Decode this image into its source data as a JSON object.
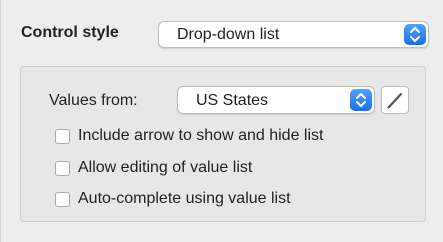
{
  "control_style": {
    "label": "Control style",
    "selected": "Drop-down list"
  },
  "values_from": {
    "label": "Values from:",
    "selected": "US States"
  },
  "options": [
    {
      "label": "Include arrow to show and hide list",
      "checked": false
    },
    {
      "label": "Allow editing of value list",
      "checked": false
    },
    {
      "label": "Auto-complete using value list",
      "checked": false
    }
  ],
  "colors": {
    "accent": "#2b84f6",
    "panel_bg": "#ededed"
  },
  "icons": {
    "stepper": "up-down-chevron-icon",
    "edit": "pencil-icon"
  }
}
